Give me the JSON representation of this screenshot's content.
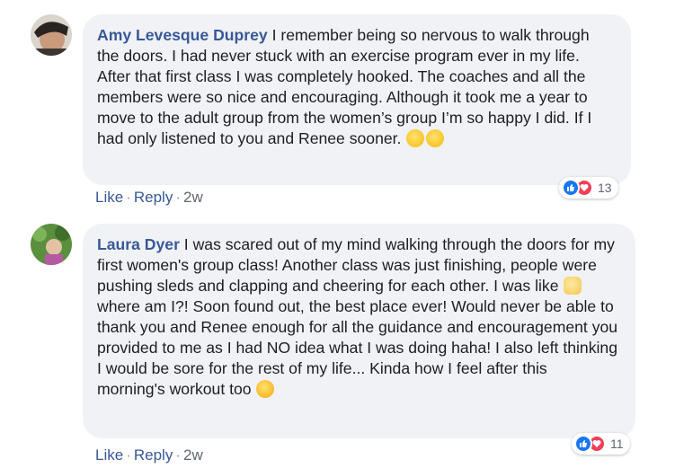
{
  "comments": [
    {
      "author": "Amy Levesque Duprey",
      "text": " I remember being so nervous to walk through the doors. I had never stuck with an exercise program ever in my life. After that first class I was completely hooked. The coaches and all the members were so nice and encouraging. Although it took me a year to move to the adult group from the women’s group I’m so happy I did. If I had only listened to you and Renee sooner. ",
      "emoji_end": [
        "smile-emoji",
        "smile-emoji"
      ],
      "reaction_count": "13",
      "actions": {
        "like": "Like",
        "reply": "Reply",
        "time": "2w",
        "sep": "·"
      }
    },
    {
      "author": "Laura Dyer",
      "text_a": " I was scared out of my mind walking through the doors for my first women's group class! Another class was just finishing, people were pushing sleds and clapping and cheering for each other. I was like ",
      "text_b": " where am I?! Soon found out, the best place ever! Would never be able to thank you and Renee enough for all the guidance and encouragement you provided to me as I had NO idea what I was doing haha! I also left thinking I would be sore for the rest of my life... Kinda how I feel after this morning's workout too ",
      "reaction_count": "11",
      "actions": {
        "like": "Like",
        "reply": "Reply",
        "time": "2w",
        "sep": "·"
      }
    }
  ],
  "colors": {
    "author": "#385898",
    "bubble": "#f0f2f5",
    "like_blue": "#1877f2",
    "love_red": "#f33e58"
  }
}
